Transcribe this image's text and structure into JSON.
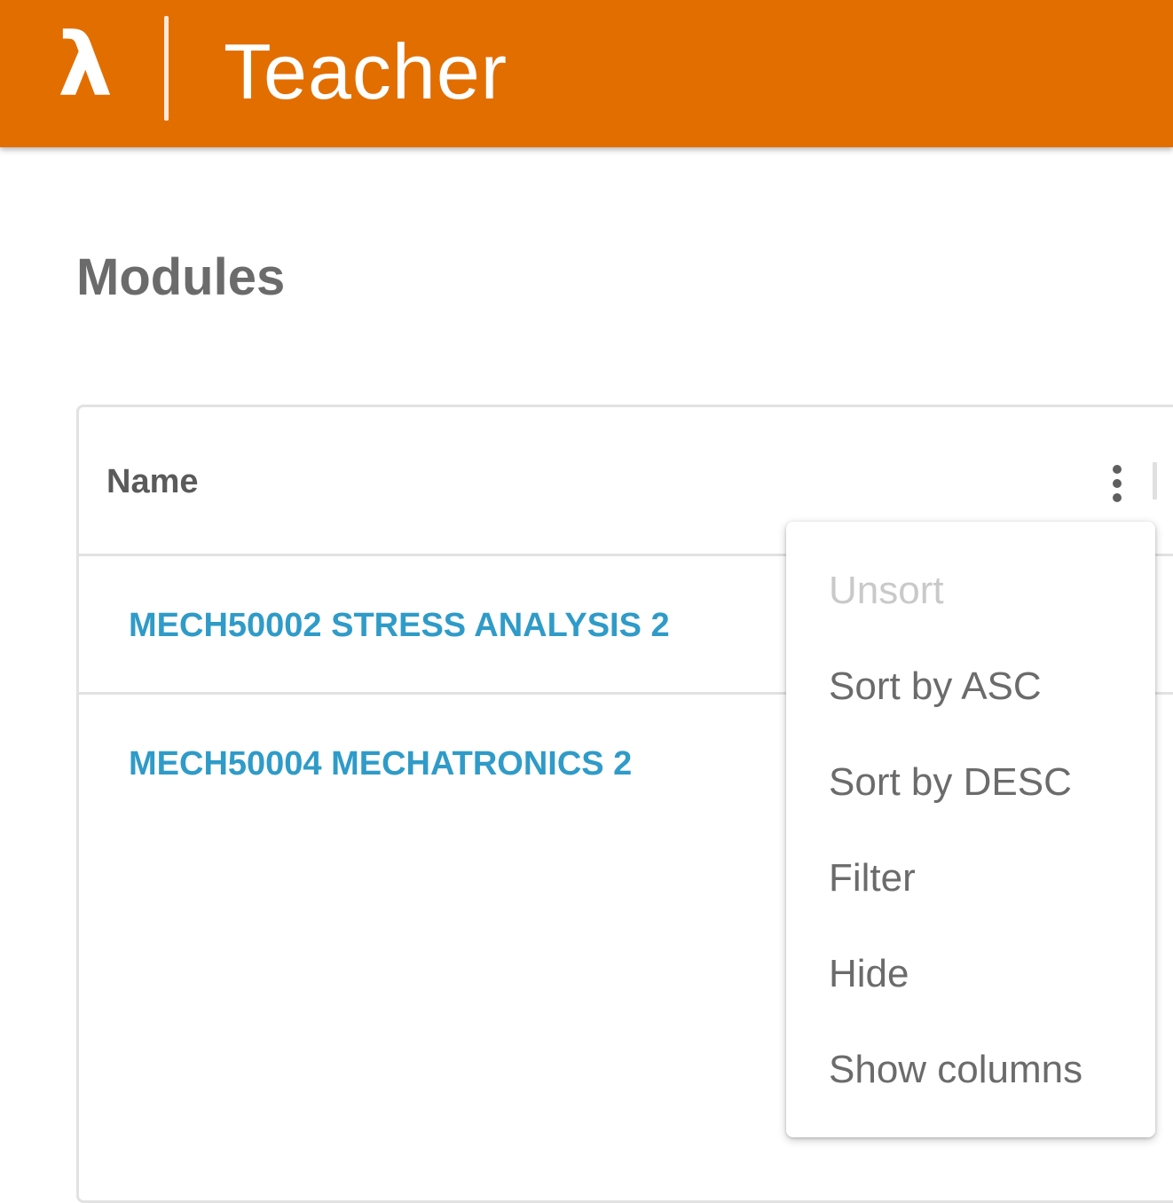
{
  "app": {
    "logo_glyph": "λ",
    "logo_icon": "lambda-logo-icon",
    "title": "Teacher",
    "brand_color": "#e36e00"
  },
  "page": {
    "title": "Modules"
  },
  "table": {
    "columns": [
      {
        "label": "Name",
        "menu_icon": "kebab-menu-icon"
      }
    ],
    "rows": [
      {
        "name": "MECH50002 STRESS ANALYSIS 2"
      },
      {
        "name": "MECH50004 MECHATRONICS 2"
      }
    ],
    "link_color": "#2f9bc8"
  },
  "column_menu": {
    "items": [
      {
        "label": "Unsort",
        "disabled": true
      },
      {
        "label": "Sort by ASC",
        "disabled": false
      },
      {
        "label": "Sort by DESC",
        "disabled": false
      },
      {
        "label": "Filter",
        "disabled": false
      },
      {
        "label": "Hide",
        "disabled": false
      },
      {
        "label": "Show columns",
        "disabled": false
      }
    ]
  }
}
